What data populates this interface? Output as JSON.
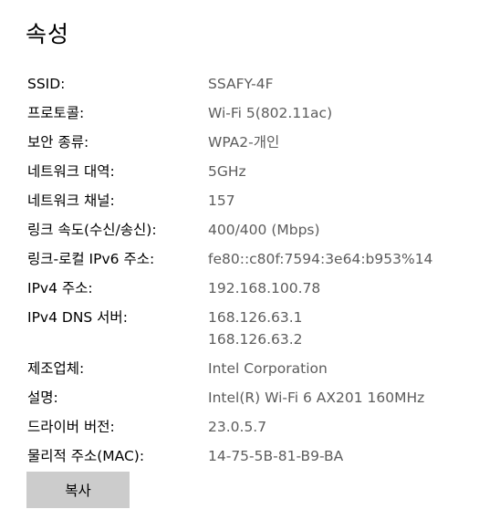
{
  "page": {
    "title": "속성"
  },
  "properties": [
    {
      "label": "SSID:",
      "value": "SSAFY-4F"
    },
    {
      "label": "프로토콜:",
      "value": "Wi-Fi 5(802.11ac)"
    },
    {
      "label": "보안 종류:",
      "value": "WPA2-개인"
    },
    {
      "label": "네트워크 대역:",
      "value": "5GHz"
    },
    {
      "label": "네트워크 채널:",
      "value": "157"
    },
    {
      "label": "링크 속도(수신/송신):",
      "value": "400/400 (Mbps)"
    },
    {
      "label": "링크-로컬 IPv6 주소:",
      "value": "fe80::c80f:7594:3e64:b953%14"
    },
    {
      "label": "IPv4 주소:",
      "value": "192.168.100.78"
    },
    {
      "label": "IPv4 DNS 서버:",
      "values": [
        "168.126.63.1",
        "168.126.63.2"
      ]
    },
    {
      "label": "제조업체:",
      "value": "Intel Corporation"
    },
    {
      "label": "설명:",
      "value": "Intel(R) Wi-Fi 6 AX201 160MHz"
    },
    {
      "label": "드라이버 버전:",
      "value": "23.0.5.7"
    },
    {
      "label": "물리적 주소(MAC):",
      "value": "14-75-5B-81-B9-BA"
    }
  ],
  "actions": {
    "copy_label": "복사"
  }
}
